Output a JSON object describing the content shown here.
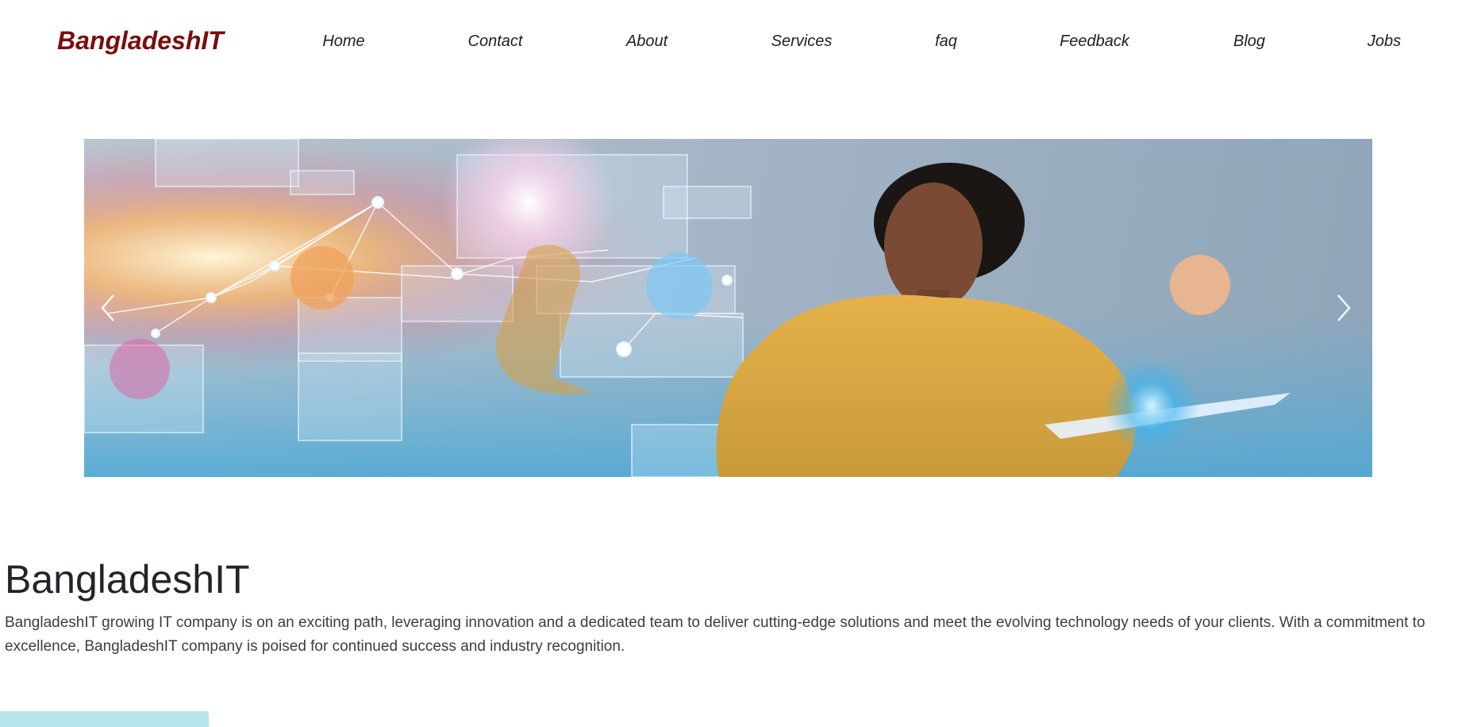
{
  "navbar": {
    "brand": "BangladeshIT",
    "links": [
      {
        "label": "Home"
      },
      {
        "label": "Contact"
      },
      {
        "label": "About"
      },
      {
        "label": "Services"
      },
      {
        "label": "faq"
      },
      {
        "label": "Feedback"
      },
      {
        "label": "Blog"
      },
      {
        "label": "Jobs"
      }
    ]
  },
  "carousel": {
    "image_icon": "hero-image-woman-touching-holographic-interface",
    "prev_icon": "chevron-left-icon",
    "next_icon": "chevron-right-icon"
  },
  "about": {
    "title": "BangladeshIT",
    "description": "BangladeshIT growing IT company is on an exciting path, leveraging innovation and a dedicated team to deliver cutting-edge solutions and meet the evolving technology needs of your clients. With a commitment to excellence, BangladeshIT company is poised for continued success and industry recognition."
  },
  "colors": {
    "brand": "#7a0d0d",
    "tag_bg": "#b6e5ec"
  }
}
